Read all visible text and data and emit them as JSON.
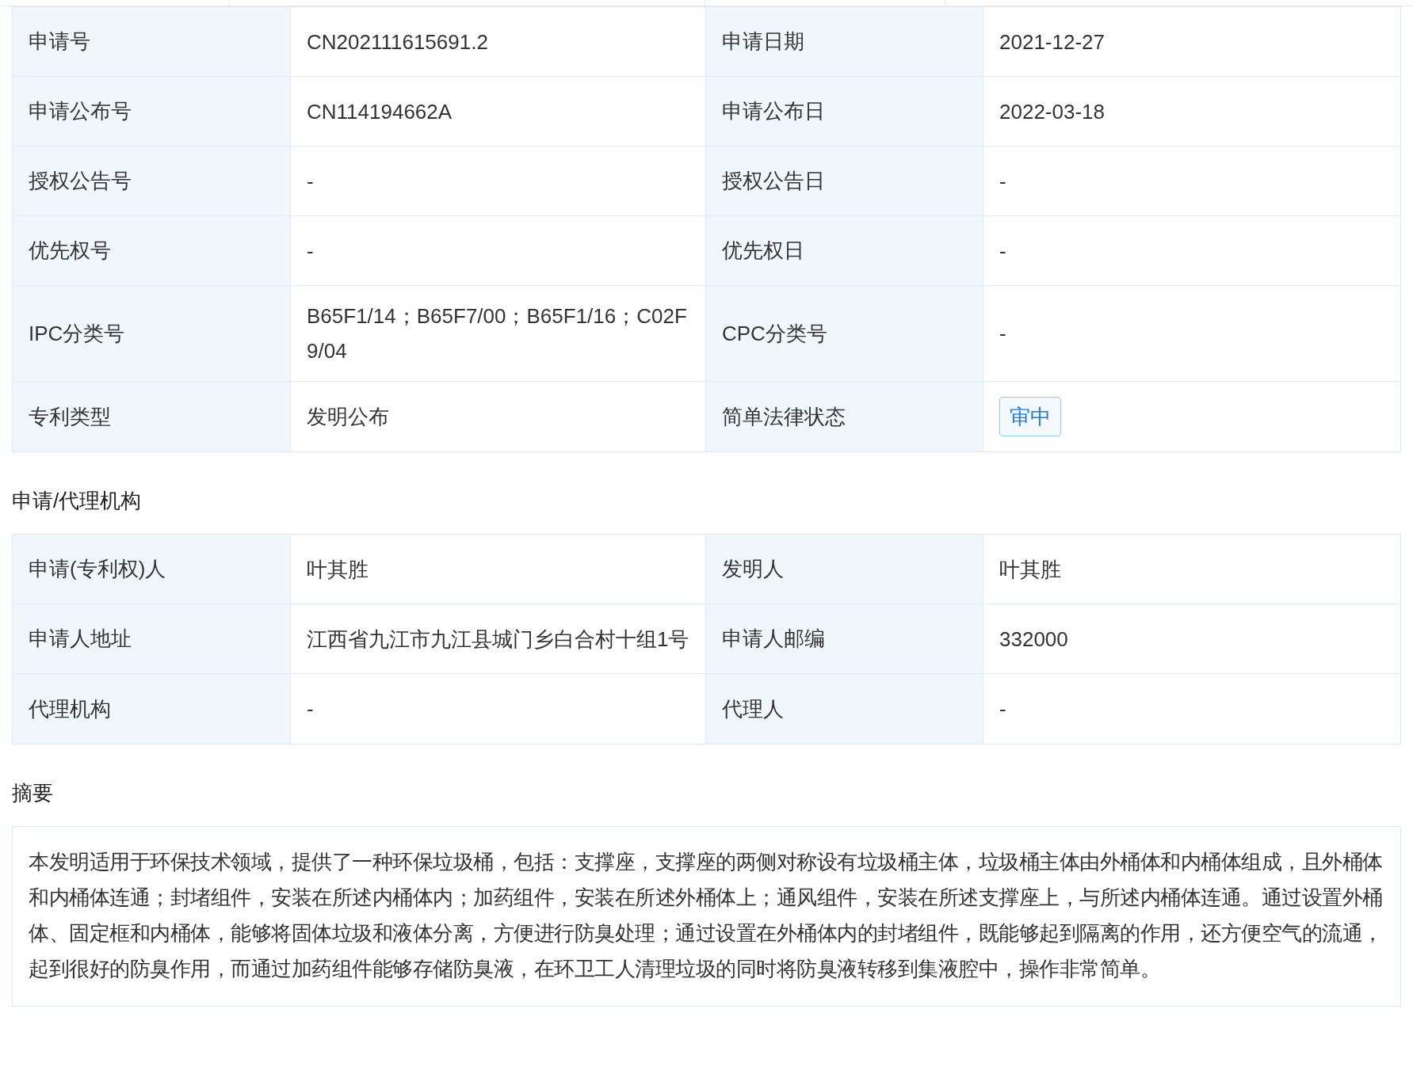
{
  "basic_table": {
    "rows": [
      {
        "cells": [
          {
            "label": "申请号",
            "value": "CN202111615691.2"
          },
          {
            "label": "申请日期",
            "value": "2021-12-27"
          }
        ]
      },
      {
        "cells": [
          {
            "label": "申请公布号",
            "value": "CN114194662A"
          },
          {
            "label": "申请公布日",
            "value": "2022-03-18"
          }
        ]
      },
      {
        "cells": [
          {
            "label": "授权公告号",
            "value": "-"
          },
          {
            "label": "授权公告日",
            "value": "-"
          }
        ]
      },
      {
        "cells": [
          {
            "label": "优先权号",
            "value": "-"
          },
          {
            "label": "优先权日",
            "value": "-"
          }
        ]
      },
      {
        "cells": [
          {
            "label": "IPC分类号",
            "value": "B65F1/14；B65F7/00；B65F1/16；C02F9/04"
          },
          {
            "label": "CPC分类号",
            "value": "-"
          }
        ]
      },
      {
        "cells": [
          {
            "label": "专利类型",
            "value": "发明公布"
          },
          {
            "label": "简单法律状态",
            "value": "审中",
            "kind": "badge"
          }
        ]
      }
    ]
  },
  "agency_section": {
    "title": "申请/代理机构",
    "rows": [
      {
        "cells": [
          {
            "label": "申请(专利权)人",
            "value": "叶其胜"
          },
          {
            "label": "发明人",
            "value": "叶其胜"
          }
        ]
      },
      {
        "cells": [
          {
            "label": "申请人地址",
            "value": "江西省九江市九江县城门乡白合村十组1号"
          },
          {
            "label": "申请人邮编",
            "value": "332000"
          }
        ]
      },
      {
        "cells": [
          {
            "label": "代理机构",
            "value": "-"
          },
          {
            "label": "代理人",
            "value": "-"
          }
        ]
      }
    ]
  },
  "abstract_section": {
    "title": "摘要",
    "text": "本发明适用于环保技术领域，提供了一种环保垃圾桶，包括：支撑座，支撑座的两侧对称设有垃圾桶主体，垃圾桶主体由外桶体和内桶体组成，且外桶体和内桶体连通；封堵组件，安装在所述内桶体内；加药组件，安装在所述外桶体上；通风组件，安装在所述支撑座上，与所述内桶体连通。通过设置外桶体、固定框和内桶体，能够将固体垃圾和液体分离，方便进行防臭处理；通过设置在外桶体内的封堵组件，既能够起到隔离的作用，还方便空气的流通，起到很好的防臭作用，而通过加药组件能够存储防臭液，在环卫工人清理垃圾的同时将防臭液转移到集液腔中，操作非常简单。"
  }
}
